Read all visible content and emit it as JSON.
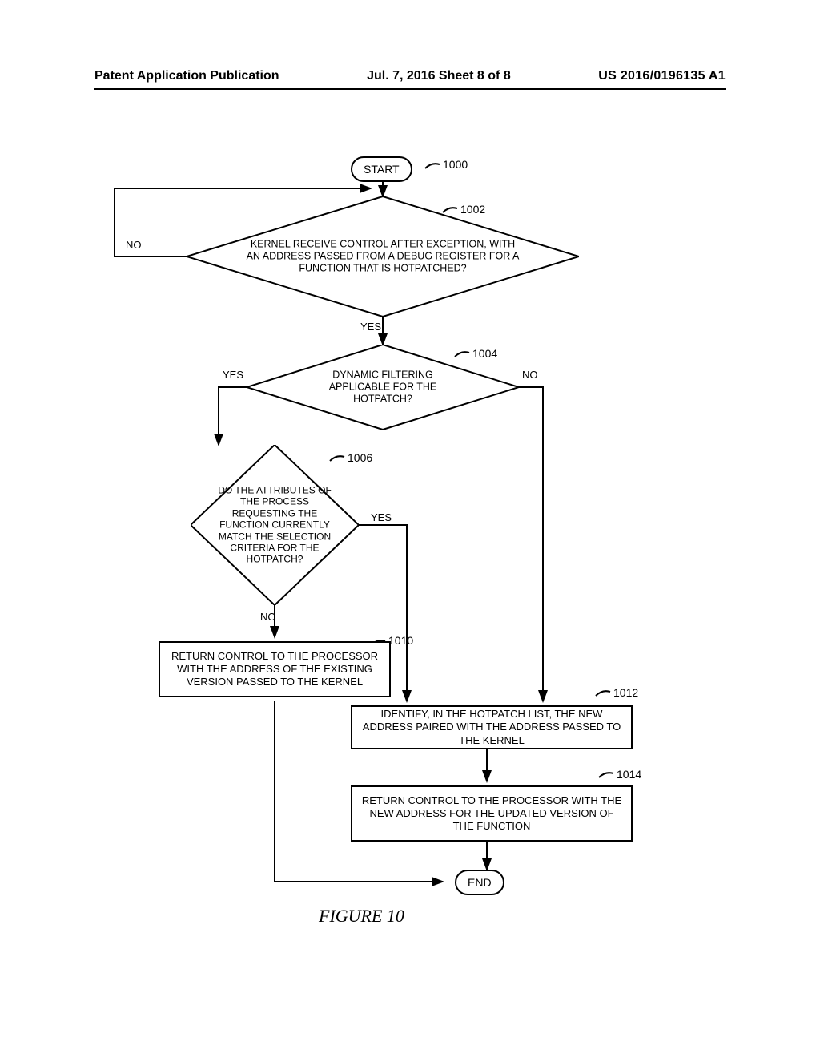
{
  "header": {
    "left": "Patent Application Publication",
    "center": "Jul. 7, 2016  Sheet 8 of 8",
    "right": "US 2016/0196135 A1"
  },
  "nodes": {
    "start": "START",
    "end": "END",
    "d1002": "KERNEL RECEIVE CONTROL AFTER EXCEPTION, WITH AN ADDRESS PASSED FROM A DEBUG REGISTER FOR A FUNCTION THAT IS HOTPATCHED?",
    "d1004": "DYNAMIC FILTERING APPLICABLE FOR THE HOTPATCH?",
    "d1006": "DO THE ATTRIBUTES OF THE PROCESS REQUESTING THE FUNCTION CURRENTLY MATCH THE SELECTION CRITERIA FOR THE HOTPATCH?",
    "p1010": "RETURN CONTROL TO THE PROCESSOR WITH THE ADDRESS OF THE EXISTING VERSION PASSED TO THE KERNEL",
    "p1012": "IDENTIFY, IN THE HOTPATCH LIST, THE NEW ADDRESS PAIRED WITH THE ADDRESS PASSED TO THE KERNEL",
    "p1014": "RETURN CONTROL TO THE PROCESSOR WITH THE NEW ADDRESS FOR THE UPDATED VERSION OF THE FUNCTION"
  },
  "refs": {
    "r1000": "1000",
    "r1002": "1002",
    "r1004": "1004",
    "r1006": "1006",
    "r1010": "1010",
    "r1012": "1012",
    "r1014": "1014"
  },
  "branches": {
    "yes": "YES",
    "no": "NO"
  },
  "caption": "FIGURE 10"
}
